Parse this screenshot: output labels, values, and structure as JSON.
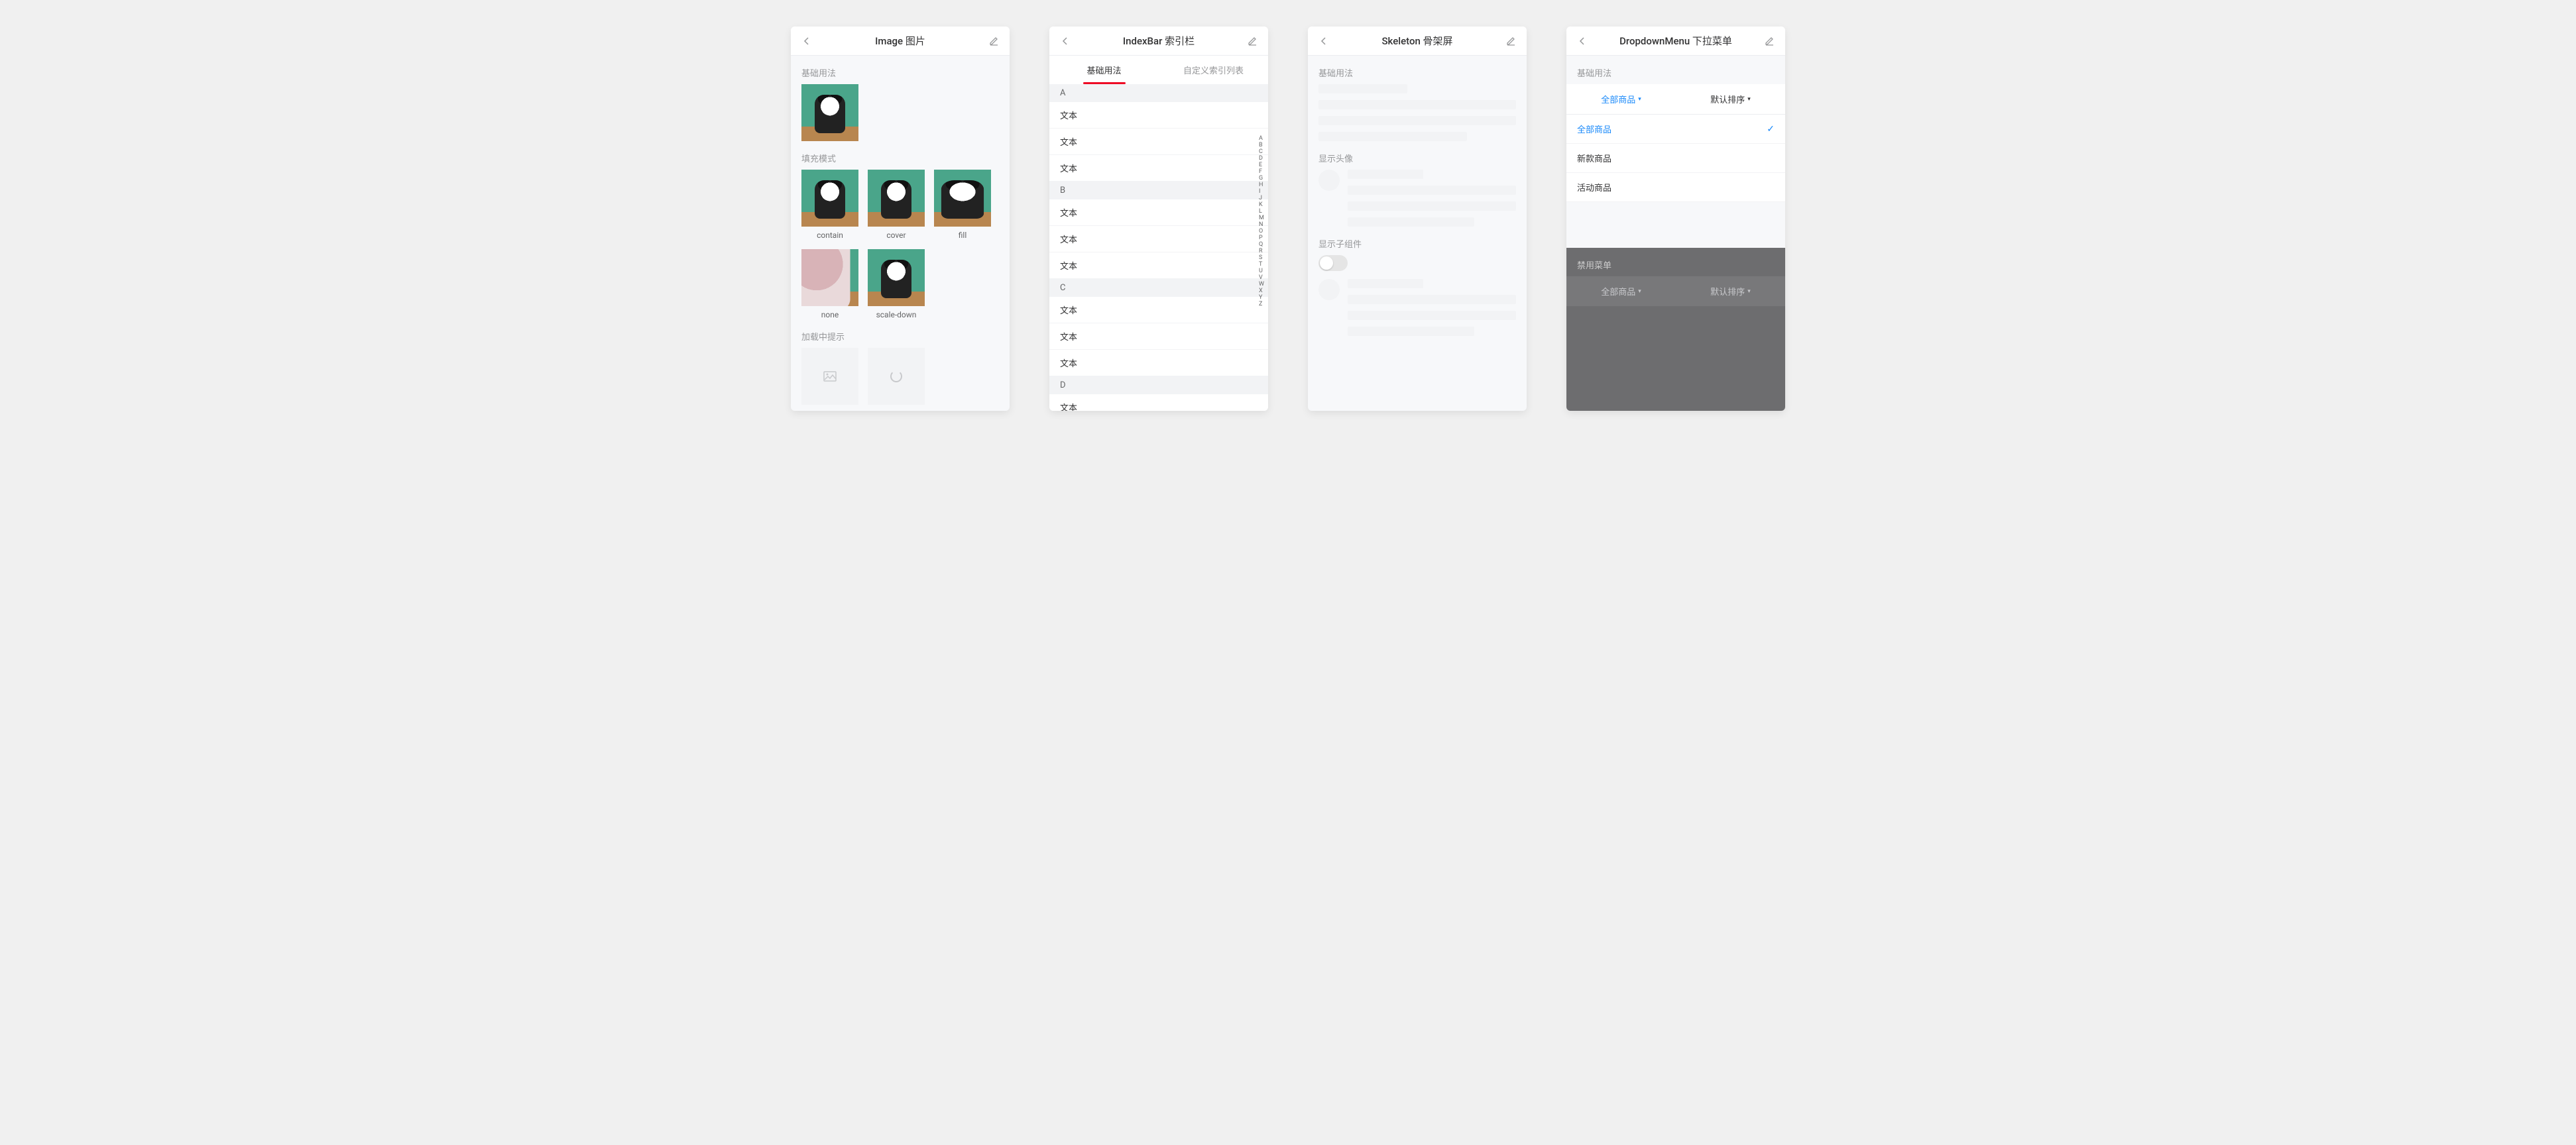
{
  "screens": {
    "image": {
      "title": "Image 图片",
      "basic": "基础用法",
      "fill_modes": "填充模式",
      "loading": "加载中提示",
      "modes": [
        "contain",
        "cover",
        "fill",
        "none",
        "scale-down"
      ]
    },
    "indexbar": {
      "title": "IndexBar 索引栏",
      "tabs": [
        "基础用法",
        "自定义索引列表"
      ],
      "cell_text": "文本",
      "groups": [
        {
          "letter": "A",
          "rows": 3
        },
        {
          "letter": "B",
          "rows": 3
        },
        {
          "letter": "C",
          "rows": 3
        },
        {
          "letter": "D",
          "rows": 1
        }
      ],
      "alphabet": [
        "A",
        "B",
        "C",
        "D",
        "E",
        "F",
        "G",
        "H",
        "I",
        "J",
        "K",
        "L",
        "M",
        "N",
        "O",
        "P",
        "Q",
        "R",
        "S",
        "T",
        "U",
        "V",
        "W",
        "X",
        "Y",
        "Z"
      ]
    },
    "skeleton": {
      "title": "Skeleton 骨架屏",
      "basic": "基础用法",
      "avatar": "显示头像",
      "child": "显示子组件"
    },
    "dropdown": {
      "title": "DropdownMenu 下拉菜单",
      "basic": "基础用法",
      "disabled": "禁用菜单",
      "menu": [
        {
          "label": "全部商品",
          "active": true
        },
        {
          "label": "默认排序",
          "active": false
        }
      ],
      "options": [
        {
          "label": "全部商品",
          "selected": true
        },
        {
          "label": "新款商品",
          "selected": false
        },
        {
          "label": "活动商品",
          "selected": false
        }
      ]
    }
  }
}
